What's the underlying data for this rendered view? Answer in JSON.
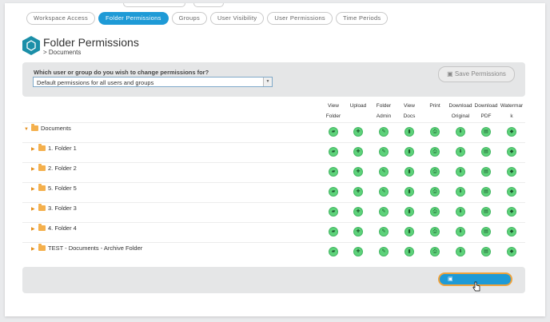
{
  "tabs": [
    {
      "label": "Workspace Access",
      "active": false
    },
    {
      "label": "Folder Permissions",
      "active": true
    },
    {
      "label": "Groups",
      "active": false
    },
    {
      "label": "User Visibility",
      "active": false
    },
    {
      "label": "User Permissions",
      "active": false
    },
    {
      "label": "Time Periods",
      "active": false
    }
  ],
  "page": {
    "title": "Folder Permissions",
    "crumb_separator": ">",
    "crumb": "Documents"
  },
  "picker": {
    "question": "Which user or group do you wish to change permissions for?",
    "selected": "Default permissions for all users and groups"
  },
  "save_label": "Save Permissions",
  "columns": [
    {
      "line1": "View",
      "line2": "Folder",
      "icon": "folder-open-icon",
      "glyph": "▰"
    },
    {
      "line1": "Upload",
      "line2": "",
      "icon": "plus-icon",
      "glyph": "✚"
    },
    {
      "line1": "Folder",
      "line2": "Admin",
      "icon": "wrench-icon",
      "glyph": "✎"
    },
    {
      "line1": "View",
      "line2": "Docs",
      "icon": "file-icon",
      "glyph": "▮"
    },
    {
      "line1": "Print",
      "line2": "",
      "icon": "printer-icon",
      "glyph": "⎙"
    },
    {
      "line1": "Download",
      "line2": "Original",
      "icon": "download-icon",
      "glyph": "⬇"
    },
    {
      "line1": "Download",
      "line2": "PDF",
      "icon": "pdf-icon",
      "glyph": "▤"
    },
    {
      "line1": "Watermar",
      "line2": "k",
      "icon": "tag-icon",
      "glyph": "◆"
    }
  ],
  "rows": [
    {
      "label": "Documents",
      "root": true
    },
    {
      "label": "1. Folder 1",
      "root": false
    },
    {
      "label": "2. Folder 2",
      "root": false
    },
    {
      "label": "5. Folder 5",
      "root": false
    },
    {
      "label": "3. Folder 3",
      "root": false
    },
    {
      "label": "4. Folder 4",
      "root": false
    },
    {
      "label": "TEST - Documents - Archive Folder",
      "root": false
    }
  ],
  "colors": {
    "accent": "#1e9ad6",
    "permission_on": "#5ed27a",
    "folder": "#f4b04d",
    "focus": "#f0a23a"
  },
  "icons": {
    "save": "save-icon",
    "cursor": "pointer-hand-icon",
    "logo": "hexagon-logo-icon"
  }
}
